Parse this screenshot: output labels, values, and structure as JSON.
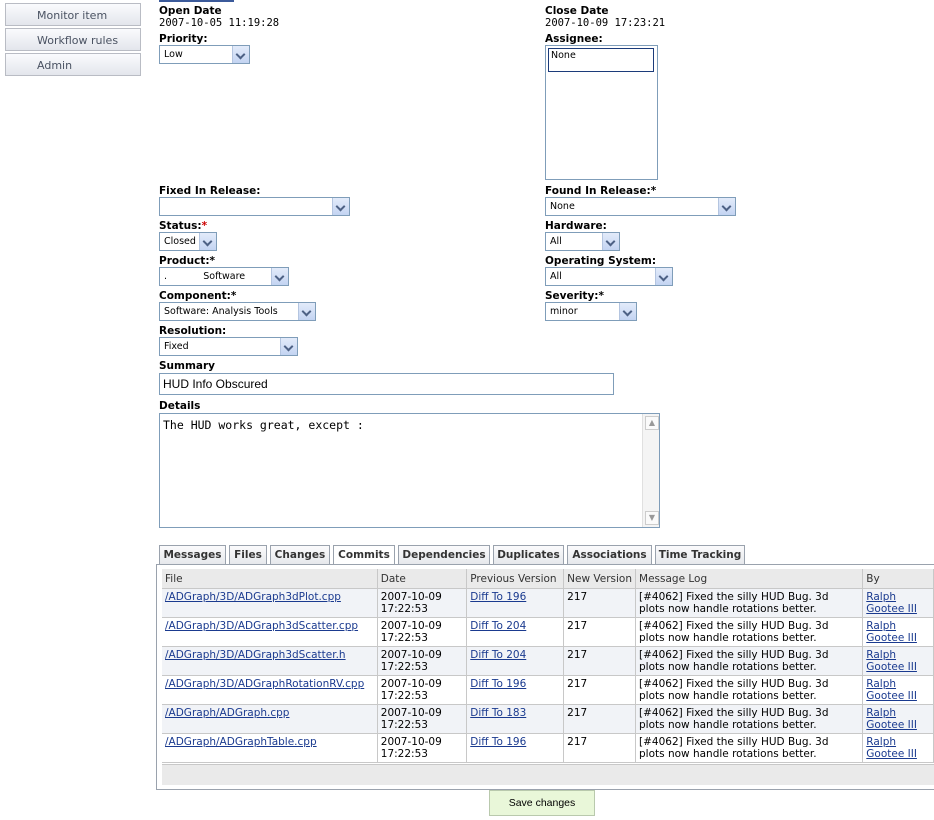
{
  "sidebar": {
    "items": [
      {
        "label": "Monitor item"
      },
      {
        "label": "Workflow rules"
      },
      {
        "label": "Admin"
      }
    ]
  },
  "form": {
    "open_date": {
      "label": "Open Date",
      "value": "2007-10-05 11:19:28"
    },
    "close_date": {
      "label": "Close Date",
      "value": "2007-10-09 17:23:21"
    },
    "priority": {
      "label": "Priority:",
      "value": "Low"
    },
    "assignee": {
      "label": "Assignee:",
      "options": [
        "None"
      ]
    },
    "fixed_in_release": {
      "label": "Fixed In Release:",
      "value": ""
    },
    "found_in_release": {
      "label": "Found In Release:",
      "required": "*",
      "value": "None"
    },
    "status": {
      "label": "Status:",
      "required": "*",
      "value": "Closed"
    },
    "hardware": {
      "label": "Hardware:",
      "value": "All"
    },
    "product": {
      "label": "Product:",
      "required": "*",
      "value": ".            Software"
    },
    "operating_system": {
      "label": "Operating System:",
      "value": "All"
    },
    "component": {
      "label": "Component:",
      "required": "*",
      "value": "Software: Analysis Tools"
    },
    "severity": {
      "label": "Severity:",
      "required": "*",
      "value": "minor"
    },
    "resolution": {
      "label": "Resolution:",
      "value": "Fixed"
    },
    "summary": {
      "label": "Summary",
      "value": "HUD Info Obscured"
    },
    "details": {
      "label": "Details",
      "value": "The HUD works great, except :"
    }
  },
  "tabs": [
    {
      "label": "Messages"
    },
    {
      "label": "Files"
    },
    {
      "label": "Changes"
    },
    {
      "label": "Commits",
      "active": true
    },
    {
      "label": "Dependencies"
    },
    {
      "label": "Duplicates"
    },
    {
      "label": "Associations"
    },
    {
      "label": "Time Tracking"
    }
  ],
  "commits": {
    "columns": [
      "File",
      "Date",
      "Previous Version",
      "New Version",
      "Message Log",
      "By"
    ],
    "rows": [
      {
        "file": "/ADGraph/3D/ADGraph3dPlot.cpp",
        "date1": "2007-10-09",
        "date2": "17:22:53",
        "prev": "Diff To 196",
        "new": "217",
        "msg1": "[#4062] Fixed the silly HUD Bug. 3d",
        "msg2": "plots now handle rotations better.",
        "by1": "Ralph",
        "by2": "Gootee III"
      },
      {
        "file": "/ADGraph/3D/ADGraph3dScatter.cpp",
        "date1": "2007-10-09",
        "date2": "17:22:53",
        "prev": "Diff To 204",
        "new": "217",
        "msg1": "[#4062] Fixed the silly HUD Bug. 3d",
        "msg2": "plots now handle rotations better.",
        "by1": "Ralph",
        "by2": "Gootee III"
      },
      {
        "file": "/ADGraph/3D/ADGraph3dScatter.h",
        "date1": "2007-10-09",
        "date2": "17:22:53",
        "prev": "Diff To 204",
        "new": "217",
        "msg1": "[#4062] Fixed the silly HUD Bug. 3d",
        "msg2": "plots now handle rotations better.",
        "by1": "Ralph",
        "by2": "Gootee III"
      },
      {
        "file": "/ADGraph/3D/ADGraphRotationRV.cpp",
        "date1": "2007-10-09",
        "date2": "17:22:53",
        "prev": "Diff To 196",
        "new": "217",
        "msg1": "[#4062] Fixed the silly HUD Bug. 3d",
        "msg2": "plots now handle rotations better.",
        "by1": "Ralph",
        "by2": "Gootee III"
      },
      {
        "file": "/ADGraph/ADGraph.cpp",
        "date1": "2007-10-09",
        "date2": "17:22:53",
        "prev": "Diff To 183",
        "new": "217",
        "msg1": "[#4062] Fixed the silly HUD Bug. 3d",
        "msg2": "plots now handle rotations better.",
        "by1": "Ralph",
        "by2": "Gootee III"
      },
      {
        "file": "/ADGraph/ADGraphTable.cpp",
        "date1": "2007-10-09",
        "date2": "17:22:53",
        "prev": "Diff To 196",
        "new": "217",
        "msg1": "[#4062] Fixed the silly HUD Bug. 3d",
        "msg2": "plots now handle rotations better.",
        "by1": "Ralph",
        "by2": "Gootee III"
      }
    ]
  },
  "save_button": {
    "label": "Save changes"
  },
  "colors": {
    "link": "#1a3a8f",
    "required": "#cc0000",
    "save_bg": "#e9f7d9"
  }
}
